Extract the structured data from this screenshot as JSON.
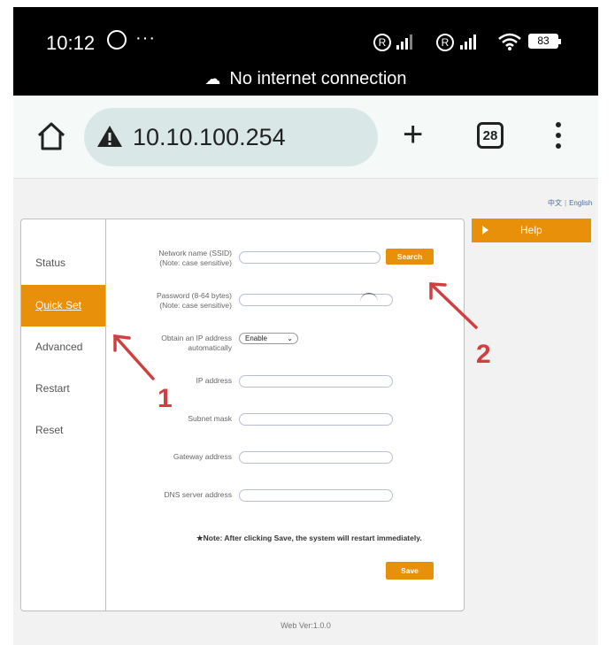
{
  "status_bar": {
    "time": "10:12",
    "dots": "···",
    "roaming1": "R",
    "roaming2": "R",
    "battery": "83",
    "notice": "No internet connection"
  },
  "browser": {
    "url": "10.10.100.254",
    "tab_count": "28"
  },
  "page": {
    "lang_zh": "中文",
    "lang_sep": "|",
    "lang_en": "English",
    "help_label": "Help",
    "footer": "Web Ver:1.0.0"
  },
  "sidebar": {
    "items": [
      {
        "label": "Status"
      },
      {
        "label": "Quick Set"
      },
      {
        "label": "Advanced"
      },
      {
        "label": "Restart"
      },
      {
        "label": "Reset"
      }
    ]
  },
  "form": {
    "ssid_label_1": "Network name (SSID)",
    "ssid_label_2": "(Note: case sensitive)",
    "password_label_1": "Password (8-64 bytes)",
    "password_label_2": "(Note: case sensitive)",
    "ip_mode_label_1": "Obtain an IP address",
    "ip_mode_label_2": "automatically",
    "ip_mode_value": "Enable",
    "ip_label": "IP address",
    "subnet_label": "Subnet mask",
    "gateway_label": "Gateway address",
    "dns_label": "DNS server address",
    "search_button": "Search",
    "note": "★Note: After clicking Save, the system will restart immediately.",
    "save_button": "Save"
  },
  "annotations": {
    "arrow1_label": "1",
    "arrow2_label": "2"
  },
  "colors": {
    "accent": "#e8900a",
    "annotation": "#d04040",
    "status_bar": "#000000",
    "url_pill": "#d9e8e6"
  }
}
